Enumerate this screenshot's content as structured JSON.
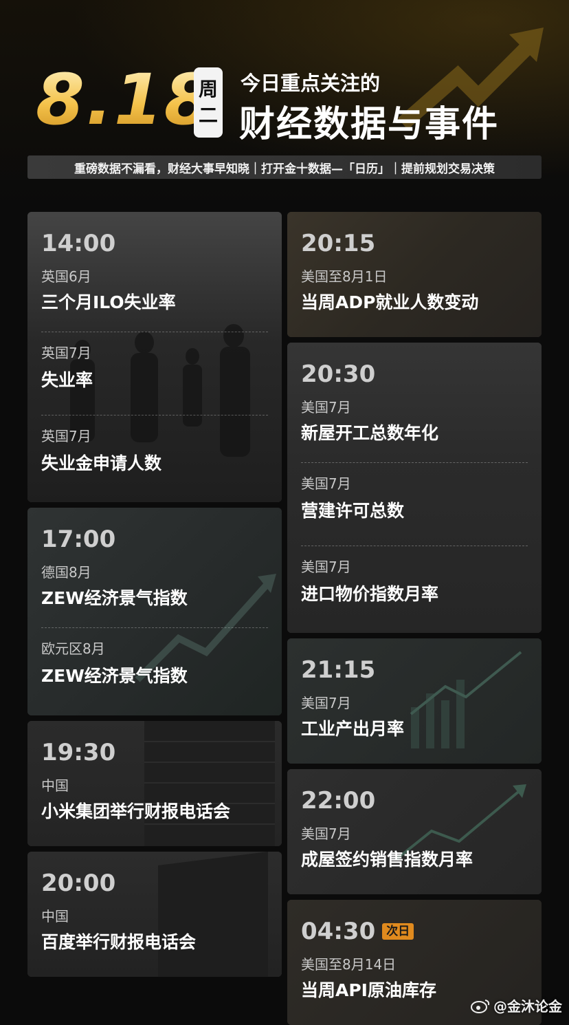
{
  "header": {
    "date": "8.18",
    "weekday": [
      "周",
      "二"
    ],
    "title_small": "今日重点关注的",
    "title_big": "财经数据与事件",
    "subtitle": "重磅数据不漏看，财经大事早知晓｜打开金十数据—「日历」｜提前规划交易决策"
  },
  "left_cards": [
    {
      "time": "14:00",
      "items": [
        {
          "region": "英国6月",
          "name": "三个月ILO失业率"
        },
        {
          "region": "英国7月",
          "name": "失业率"
        },
        {
          "region": "英国7月",
          "name": "失业金申请人数"
        }
      ]
    },
    {
      "time": "17:00",
      "items": [
        {
          "region": "德国8月",
          "name": "ZEW经济景气指数"
        },
        {
          "region": "欧元区8月",
          "name": "ZEW经济景气指数"
        }
      ]
    },
    {
      "time": "19:30",
      "items": [
        {
          "region": "中国",
          "name": "小米集团举行财报电话会"
        }
      ]
    },
    {
      "time": "20:00",
      "items": [
        {
          "region": "中国",
          "name": "百度举行财报电话会"
        }
      ]
    }
  ],
  "right_cards": [
    {
      "time": "20:15",
      "items": [
        {
          "region": "美国至8月1日",
          "name": "当周ADP就业人数变动"
        }
      ]
    },
    {
      "time": "20:30",
      "items": [
        {
          "region": "美国7月",
          "name": "新屋开工总数年化"
        },
        {
          "region": "美国7月",
          "name": "营建许可总数"
        },
        {
          "region": "美国7月",
          "name": "进口物价指数月率"
        }
      ]
    },
    {
      "time": "21:15",
      "items": [
        {
          "region": "美国7月",
          "name": "工业产出月率"
        }
      ]
    },
    {
      "time": "22:00",
      "items": [
        {
          "region": "美国7月",
          "name": "成屋签约销售指数月率"
        }
      ]
    },
    {
      "time": "04:30",
      "tag": "次日",
      "items": [
        {
          "region": "美国至8月14日",
          "name": "当周API原油库存"
        }
      ]
    }
  ],
  "watermark": "@金沐论金",
  "colors": {
    "date_gold": "#f4c24a",
    "tag_orange": "#e08a1e",
    "card_bg": "#2a2a2a"
  }
}
